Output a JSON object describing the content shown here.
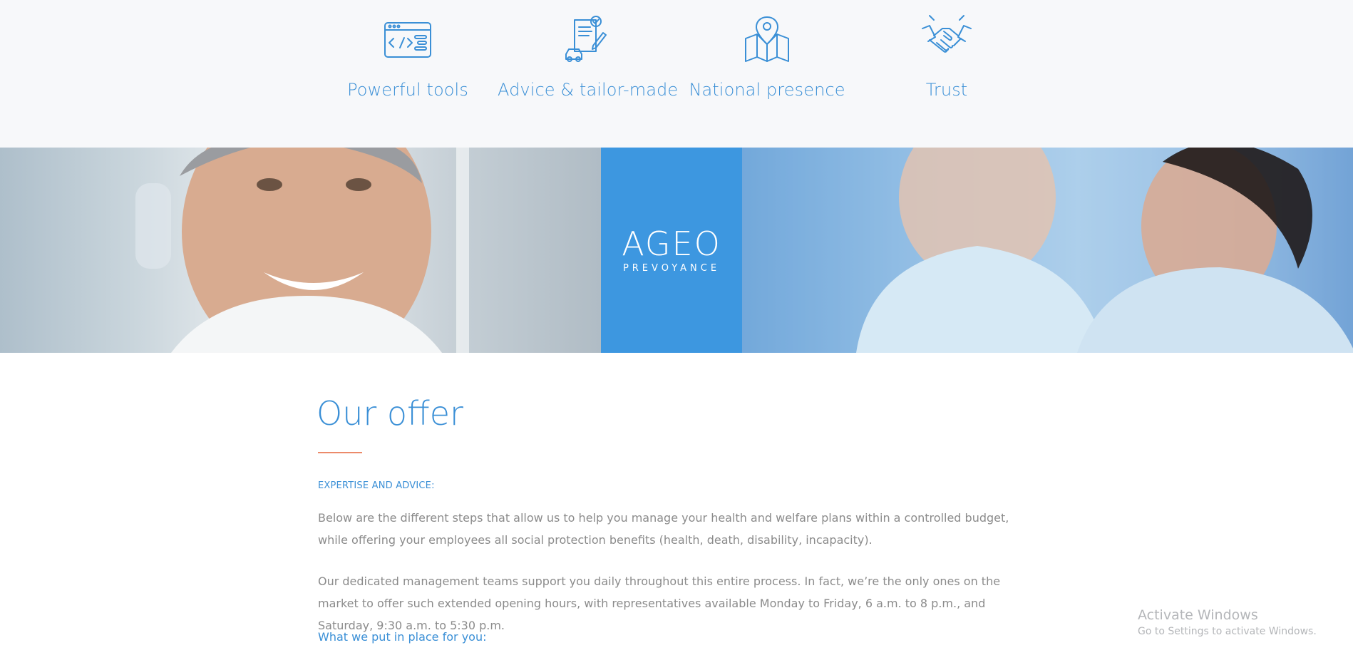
{
  "features": [
    {
      "label": "Powerful tools",
      "icon": "code-window-icon"
    },
    {
      "label": "Advice & tailor-made",
      "icon": "document-pen-car-icon"
    },
    {
      "label": "National presence",
      "icon": "map-pin-icon"
    },
    {
      "label": "Trust",
      "icon": "handshake-icon"
    }
  ],
  "banner": {
    "logo_main": "AGEO",
    "logo_sub": "PREVOYANCE",
    "logo_color": "#3d97e0"
  },
  "offer": {
    "title": "Our offer",
    "kicker": "EXPERTISE AND ADVICE:",
    "para1": "Below are the different steps that allow us to help you manage your health and welfare plans within a controlled budget, while offering your employees all social protection benefits (health, death, disability, incapacity).",
    "para2": "Our dedicated management teams support you daily throughout this entire process. In fact, we’re the only ones on the market to offer such extended opening hours, with representatives available Monday to Friday, 6 a.m. to 8 p.m., and Saturday, 9:30 a.m. to 5:30 p.m.",
    "subheading": "What we put in place for you:"
  },
  "watermark": {
    "title": "Activate Windows",
    "subtitle": "Go to Settings to activate Windows."
  },
  "colors": {
    "accent_blue": "#3a8fd6",
    "accent_orange": "#ec8a6a",
    "body_text": "#8b8b8b"
  }
}
